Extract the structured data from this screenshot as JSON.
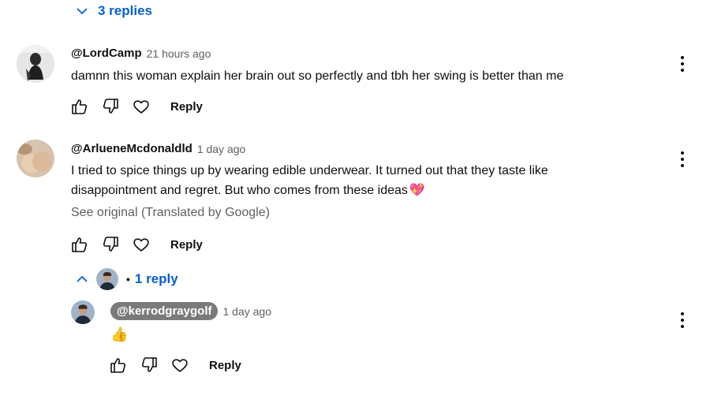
{
  "top_toggle": {
    "label": "3 replies"
  },
  "comments": [
    {
      "author": "@LordCamp",
      "time": "21 hours ago",
      "text": "damnn this woman explain her brain out so perfectly and tbh her swing is better than me",
      "reply_label": "Reply"
    },
    {
      "author": "@ArlueneMcdonaldld",
      "time": "1 day ago",
      "text_line1": "I tried to spice things up by wearing edible underwear. It turned out that they taste like",
      "text_line2": "disappointment and regret. But who comes from these ideas",
      "emoji": "💖",
      "see_original": "See original (Translated by Google)",
      "reply_label": "Reply",
      "replies_toggle": {
        "label": "1 reply",
        "bullet": "•"
      }
    }
  ],
  "reply": {
    "author": "@kerrodgraygolf",
    "time": "1 day ago",
    "emoji": "👍",
    "reply_label": "Reply"
  },
  "colors": {
    "link_blue": "#065fd4",
    "meta_gray": "#606060",
    "chip_gray": "#7a7a7a"
  },
  "icons": [
    "chevron-down-icon",
    "chevron-up-icon",
    "thumb-up-icon",
    "thumb-down-icon",
    "heart-icon",
    "kebab-menu-icon"
  ]
}
